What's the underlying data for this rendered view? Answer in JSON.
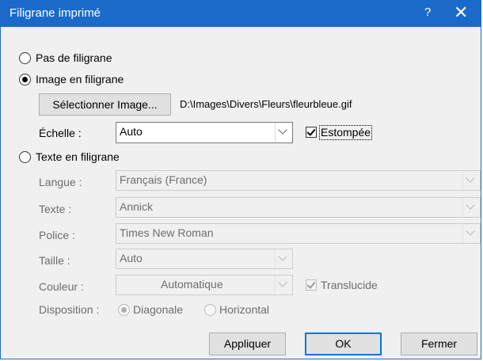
{
  "window": {
    "title": "Filigrane imprimé",
    "help_glyph": "?",
    "close_glyph": "✕"
  },
  "options": {
    "none_label": "Pas de filigrane",
    "image_label": "Image en filigrane",
    "text_label": "Texte en filigrane",
    "selected": "image"
  },
  "image": {
    "select_button": "Sélectionner Image...",
    "path": "D:\\Images\\Divers\\Fleurs\\fleurbleue.gif",
    "scale_label": "Échelle :",
    "scale_value": "Auto",
    "washout_label": "Estompée",
    "washout_checked": true
  },
  "text": {
    "language_label": "Langue :",
    "language_value": "Français (France)",
    "text_label": "Texte :",
    "text_value": "Annick",
    "font_label": "Police :",
    "font_value": "Times New Roman",
    "size_label": "Taille :",
    "size_value": "Auto",
    "color_label": "Couleur :",
    "color_value": "Automatique",
    "translucent_label": "Translucide",
    "translucent_checked": true,
    "layout_label": "Disposition :",
    "diagonal_label": "Diagonale",
    "horizontal_label": "Horizontal",
    "layout_selected": "diagonal"
  },
  "buttons": {
    "apply": "Appliquer",
    "ok": "OK",
    "close": "Fermer"
  },
  "colors": {
    "title_bar": "#1b6ac9",
    "default_button_border": "#0078d7"
  }
}
